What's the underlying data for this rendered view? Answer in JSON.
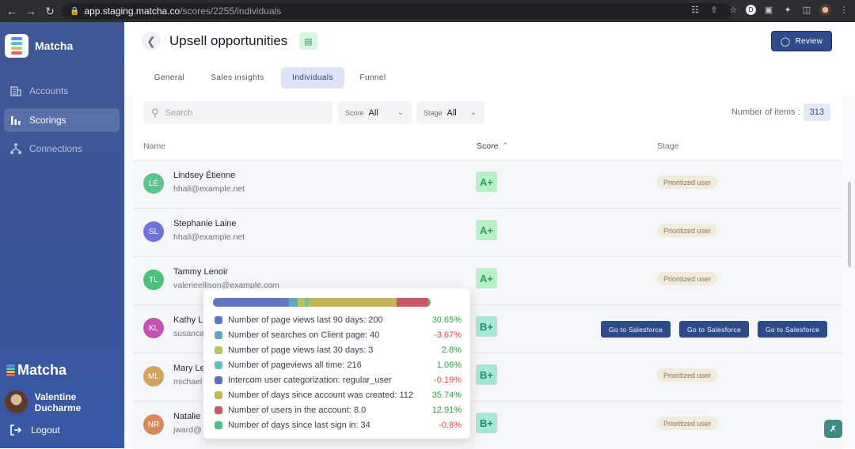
{
  "browser": {
    "url_domain": "app.staging.matcha.co",
    "url_path": "/scores/2255/individuals"
  },
  "sidebar": {
    "app_name": "Matcha",
    "items": [
      {
        "label": "Accounts",
        "icon": "building-icon",
        "active": false
      },
      {
        "label": "Scorings",
        "icon": "bar-chart-icon",
        "active": true
      },
      {
        "label": "Connections",
        "icon": "network-icon",
        "active": false
      }
    ],
    "brand": "Matcha",
    "user_name": "Valentine Ducharme",
    "logout_label": "Logout"
  },
  "header": {
    "title": "Upsell opportunities",
    "review_label": "Review",
    "tabs": [
      {
        "label": "General",
        "active": false
      },
      {
        "label": "Sales insights",
        "active": false
      },
      {
        "label": "Individuals",
        "active": true
      },
      {
        "label": "Funnel",
        "active": false
      }
    ]
  },
  "filters": {
    "search_placeholder": "Search",
    "score_label": "Score",
    "score_value": "All",
    "stage_label": "Stage",
    "stage_value": "All",
    "count_label": "Number of items :",
    "count_value": "313"
  },
  "table": {
    "columns": [
      "Name",
      "Score",
      "Stage"
    ],
    "rows": [
      {
        "initials": "LÉ",
        "name": "Lindsey Étienne",
        "email": "hhall@example.net",
        "score": "A+",
        "stage": "Prioritized user",
        "avatar_color": "#5cc48a"
      },
      {
        "initials": "SL",
        "name": "Stephanie Laine",
        "email": "hhall@example.net",
        "score": "A+",
        "stage": "Prioritized user",
        "avatar_color": "#6f74d8"
      },
      {
        "initials": "TL",
        "name": "Tammy Lenoir",
        "email": "valerieellison@example.com",
        "score": "A+",
        "stage": "Prioritized user",
        "avatar_color": "#4fbf7d"
      },
      {
        "initials": "KL",
        "name": "Kathy L",
        "email": "susanca",
        "score": "B+",
        "stage": "",
        "avatar_color": "#c451b4"
      },
      {
        "initials": "ML",
        "name": "Mary Le",
        "email": "michael",
        "score": "B+",
        "stage": "Prioritized user",
        "avatar_color": "#d3a25c"
      },
      {
        "initials": "NR",
        "name": "Natalie",
        "email": "jward@",
        "score": "B+",
        "stage": "Prioritized user",
        "avatar_color": "#d8895b"
      }
    ],
    "salesforce_label": "Go to Salesforce"
  },
  "popup": {
    "segments": [
      {
        "color": "#5b78c7",
        "share": 30.65
      },
      {
        "color": "#5aa8c8",
        "share": 3.67
      },
      {
        "color": "#b7c45a",
        "share": 2.8
      },
      {
        "color": "#5cc3c0",
        "share": 1.06
      },
      {
        "color": "#5b6fbf",
        "share": 0.19
      },
      {
        "color": "#c7b354",
        "share": 35.74
      },
      {
        "color": "#cd5666",
        "share": 12.91
      },
      {
        "color": "#4fbf8a",
        "share": 0.8
      }
    ],
    "items": [
      {
        "label": "Number of page views last 90 days: 200",
        "pct": "30.65%",
        "color": "#5b78c7",
        "positive": true
      },
      {
        "label": "Number of searches on Client page: 40",
        "pct": "-3.67%",
        "color": "#5aa8c8",
        "positive": false
      },
      {
        "label": "Number of page views last 30 days: 3",
        "pct": "2.8%",
        "color": "#b7c45a",
        "positive": true
      },
      {
        "label": "Number of pageviews all time: 216",
        "pct": "1.06%",
        "color": "#5cc3c0",
        "positive": true
      },
      {
        "label": "Intercom user categorization: regular_user",
        "pct": "-0.19%",
        "color": "#5b6fbf",
        "positive": false
      },
      {
        "label": "Number of days since account was created: 112",
        "pct": "35.74%",
        "color": "#c7b354",
        "positive": true
      },
      {
        "label": "Number of users in the account: 8.0",
        "pct": "12.91%",
        "color": "#cd5666",
        "positive": true
      },
      {
        "label": "Number of days since last sign in: 34",
        "pct": "-0.8%",
        "color": "#4fbf8a",
        "positive": false
      }
    ]
  }
}
